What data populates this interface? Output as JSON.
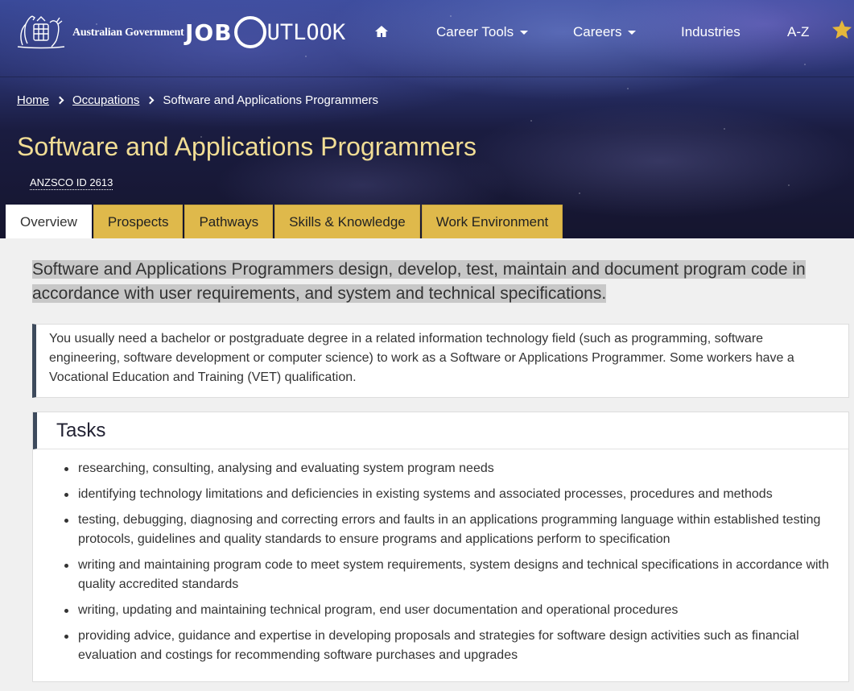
{
  "header": {
    "gov_label": "Australian Government",
    "logo_job": "JOB",
    "logo_outlook": "UTLOOK"
  },
  "nav": {
    "home_icon": "home-icon",
    "career_tools": "Career Tools",
    "careers": "Careers",
    "industries": "Industries",
    "az": "A-Z",
    "favourite_icon": "star-icon",
    "favourite_color": "#e5b73b"
  },
  "breadcrumb": {
    "home": "Home",
    "occupations": "Occupations",
    "current": "Software and Applications Programmers"
  },
  "page": {
    "title": "Software and Applications Programmers",
    "anzsco": "ANZSCO ID 2613",
    "title_color": "#f1dd95"
  },
  "tabs": [
    "Overview",
    "Prospects",
    "Pathways",
    "Skills & Knowledge",
    "Work Environment"
  ],
  "intro": "Software and Applications Programmers design, develop, test, maintain and document program code in accordance with user requirements, and system and technical specifications.",
  "callout": "You usually need a bachelor or postgraduate degree in a related information technology field (such as programming, software engineering, software development or computer science) to work as a Software or Applications Programmer. Some workers have a Vocational Education and Training (VET) qualification.",
  "tasks": {
    "heading": "Tasks",
    "items": [
      "researching, consulting, analysing and evaluating system program needs",
      "identifying technology limitations and deficiencies in existing systems and associated processes, procedures and methods",
      "testing, debugging, diagnosing and correcting errors and faults in an applications programming language within established testing protocols, guidelines and quality standards to ensure programs and applications perform to specification",
      "writing and maintaining program code to meet system requirements, system designs and technical specifications in accordance with quality accredited standards",
      "writing, updating and maintaining technical program, end user documentation and operational procedures",
      "providing advice, guidance and expertise in developing proposals and strategies for software design activities such as financial evaluation and costings for recommending software purchases and upgrades"
    ]
  }
}
